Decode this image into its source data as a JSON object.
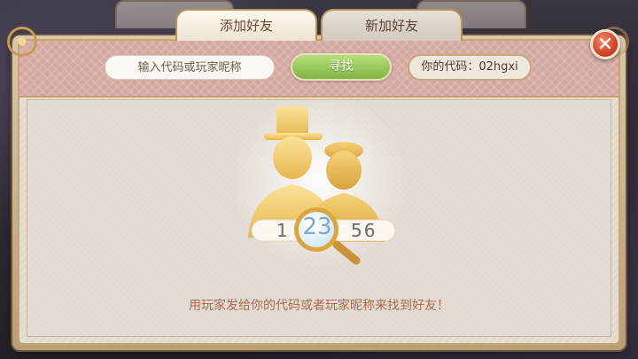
{
  "tabs": [
    {
      "label": "添加好友",
      "active": true
    },
    {
      "label": "新加好友",
      "active": false
    }
  ],
  "search": {
    "placeholder": "输入代码或玩家昵称",
    "button_label": "寻找"
  },
  "player_code": {
    "text": "你的代码：02hgxi"
  },
  "illustration": {
    "left_digit": "1",
    "magnified_digits": "23",
    "right_digits": "56"
  },
  "hint": "用玩家发给你的代码或者玩家昵称来找到好友！",
  "colors": {
    "accent_gold": "#c79a52",
    "button_green": "#8cc04e",
    "close_red": "#d2432b",
    "hint_text": "#b06a4a"
  },
  "icons": [
    "close-icon",
    "magnifier-icon",
    "silhouette-icon"
  ]
}
